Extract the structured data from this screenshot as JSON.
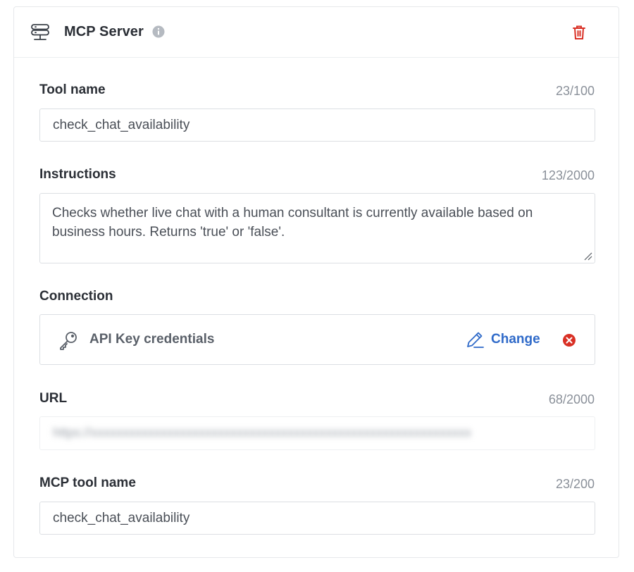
{
  "header": {
    "title": "MCP Server",
    "icon": "server-icon",
    "info_icon": "info-icon",
    "delete_icon": "trash-icon",
    "delete_color": "#d93025"
  },
  "fields": {
    "tool_name": {
      "label": "Tool name",
      "counter": "23/100",
      "value": "check_chat_availability"
    },
    "instructions": {
      "label": "Instructions",
      "counter": "123/2000",
      "value": "Checks whether live chat with a human consultant is currently available based on business hours. Returns 'true' or 'false'."
    },
    "connection": {
      "label": "Connection",
      "credential_icon": "key-icon",
      "credential_label": "API Key credentials",
      "change_label": "Change",
      "change_icon": "pencil-icon",
      "remove_icon": "remove-icon",
      "accent_color": "#2f6ac9"
    },
    "url": {
      "label": "URL",
      "counter": "68/2000",
      "value": "https://xxxxxxxxxxxxxxxxxxxxxxxxxxxxxxxxxxxxxxxxxxxxxxxxxxxxxxxxxxxx"
    },
    "mcp_tool_name": {
      "label": "MCP tool name",
      "counter": "23/200",
      "value": "check_chat_availability"
    }
  }
}
